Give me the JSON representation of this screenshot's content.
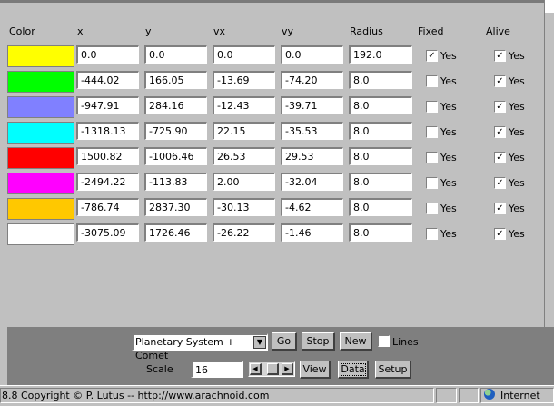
{
  "columns": {
    "color": "Color",
    "x": "x",
    "y": "y",
    "vx": "vx",
    "vy": "vy",
    "radius": "Radius",
    "fixed": "Fixed",
    "alive": "Alive"
  },
  "rows": [
    {
      "color": "#ffff00",
      "x": "0.0",
      "y": "0.0",
      "vx": "0.0",
      "vy": "0.0",
      "radius": "192.0",
      "fixed": true,
      "alive": true
    },
    {
      "color": "#00ff00",
      "x": "-444.02",
      "y": "166.05",
      "vx": "-13.69",
      "vy": "-74.20",
      "radius": "8.0",
      "fixed": false,
      "alive": true
    },
    {
      "color": "#8080ff",
      "x": "-947.91",
      "y": "284.16",
      "vx": "-12.43",
      "vy": "-39.71",
      "radius": "8.0",
      "fixed": false,
      "alive": true
    },
    {
      "color": "#00ffff",
      "x": "-1318.13",
      "y": "-725.90",
      "vx": "22.15",
      "vy": "-35.53",
      "radius": "8.0",
      "fixed": false,
      "alive": true
    },
    {
      "color": "#ff0000",
      "x": "1500.82",
      "y": "-1006.46",
      "vx": "26.53",
      "vy": "29.53",
      "radius": "8.0",
      "fixed": false,
      "alive": true
    },
    {
      "color": "#ff00ff",
      "x": "-2494.22",
      "y": "-113.83",
      "vx": "2.00",
      "vy": "-32.04",
      "radius": "8.0",
      "fixed": false,
      "alive": true
    },
    {
      "color": "#ffc800",
      "x": "-786.74",
      "y": "2837.30",
      "vx": "-30.13",
      "vy": "-4.62",
      "radius": "8.0",
      "fixed": false,
      "alive": true
    },
    {
      "color": "#ffffff",
      "x": "-3075.09",
      "y": "1726.46",
      "vx": "-26.22",
      "vy": "-1.46",
      "radius": "8.0",
      "fixed": false,
      "alive": true
    }
  ],
  "yes_label": "Yes",
  "controls": {
    "preset": "Planetary System + Comet",
    "go": "Go",
    "stop": "Stop",
    "new": "New",
    "lines": "Lines",
    "lines_checked": false,
    "scale_label": "Scale",
    "scale_value": "16",
    "view": "View",
    "data": "Data",
    "setup": "Setup"
  },
  "status": {
    "text": "8.8 Copyright © P. Lutus -- http://www.arachnoid.com",
    "zone": "Internet",
    "zone_icon": "globe-icon"
  }
}
